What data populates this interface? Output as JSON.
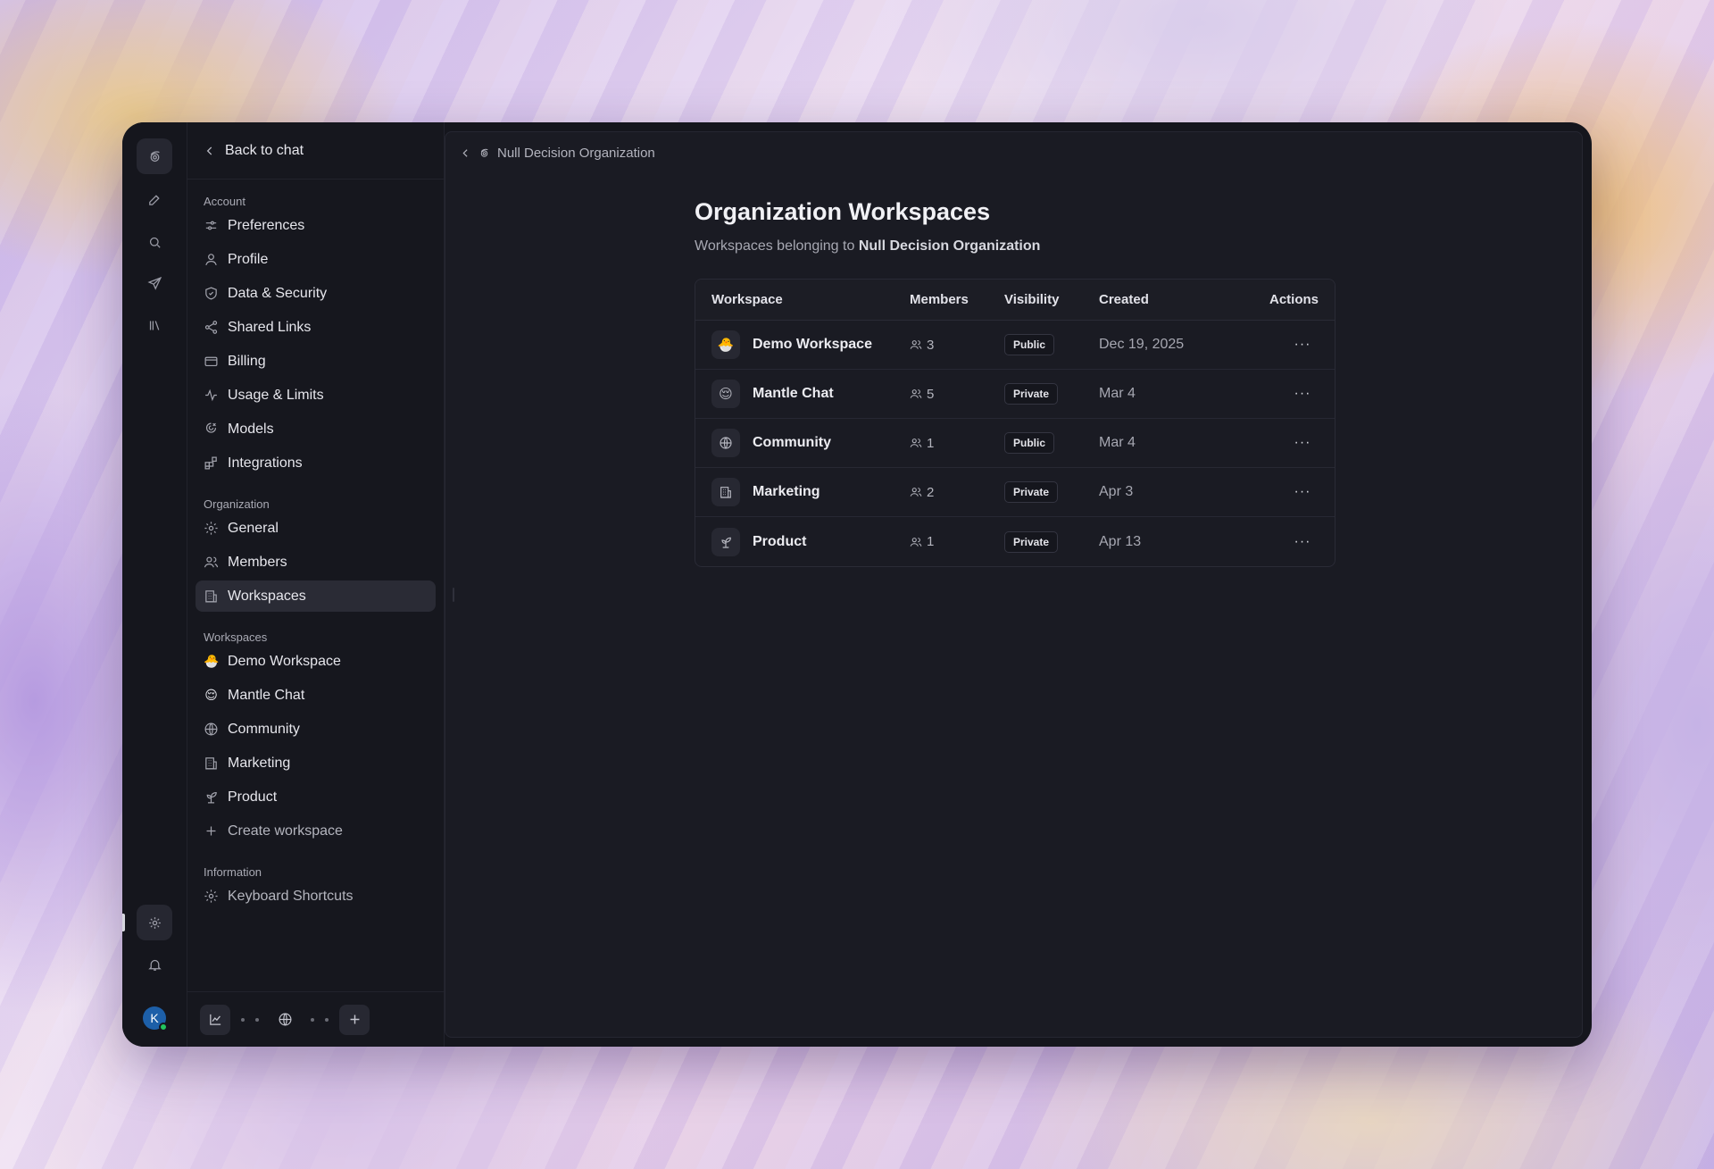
{
  "back_label": "Back to chat",
  "breadcrumb": "Null Decision Organization",
  "sections": {
    "account": {
      "label": "Account",
      "items": [
        {
          "label": "Preferences",
          "icon": "sliders-icon"
        },
        {
          "label": "Profile",
          "icon": "user-icon"
        },
        {
          "label": "Data & Security",
          "icon": "shield-icon"
        },
        {
          "label": "Shared Links",
          "icon": "share-icon"
        },
        {
          "label": "Billing",
          "icon": "card-icon"
        },
        {
          "label": "Usage & Limits",
          "icon": "activity-icon"
        },
        {
          "label": "Models",
          "icon": "models-icon"
        },
        {
          "label": "Integrations",
          "icon": "integrations-icon"
        }
      ]
    },
    "organization": {
      "label": "Organization",
      "items": [
        {
          "label": "General",
          "icon": "gear-icon"
        },
        {
          "label": "Members",
          "icon": "users-icon"
        },
        {
          "label": "Workspaces",
          "icon": "building-icon"
        }
      ]
    },
    "workspaces": {
      "label": "Workspaces",
      "items": [
        {
          "label": "Demo Workspace",
          "emoji": "🐣"
        },
        {
          "label": "Mantle Chat",
          "emoji": "😌"
        },
        {
          "label": "Community",
          "icon": "globe-icon"
        },
        {
          "label": "Marketing",
          "icon": "building-icon"
        },
        {
          "label": "Product",
          "icon": "sprout-icon"
        }
      ],
      "create_label": "Create workspace"
    },
    "information": {
      "label": "Information",
      "items": [
        {
          "label": "Keyboard Shortcuts",
          "icon": "gear-icon"
        }
      ]
    }
  },
  "avatar_initial": "K",
  "main": {
    "title": "Organization Workspaces",
    "subtitle_prefix": "Workspaces belonging to",
    "subtitle_org": "Null Decision Organization",
    "table": {
      "headers": [
        "Workspace",
        "Members",
        "Visibility",
        "Created",
        "Actions"
      ],
      "rows": [
        {
          "name": "Demo Workspace",
          "emoji": "🐣",
          "members": "3",
          "visibility": "Public",
          "created": "Dec 19, 2025"
        },
        {
          "name": "Mantle Chat",
          "emoji": "😌",
          "members": "5",
          "visibility": "Private",
          "created": "Mar 4"
        },
        {
          "name": "Community",
          "icon": "globe-icon",
          "members": "1",
          "visibility": "Public",
          "created": "Mar 4"
        },
        {
          "name": "Marketing",
          "icon": "building-icon",
          "members": "2",
          "visibility": "Private",
          "created": "Apr 3"
        },
        {
          "name": "Product",
          "icon": "sprout-icon",
          "members": "1",
          "visibility": "Private",
          "created": "Apr 13"
        }
      ],
      "action_glyph": "···"
    }
  },
  "colors": {
    "window_bg": "#15161d",
    "main_bg": "#1a1b23",
    "active_item_bg": "#2a2b35",
    "avatar_bg": "#1d5fa8",
    "online_dot": "#22c55e"
  }
}
